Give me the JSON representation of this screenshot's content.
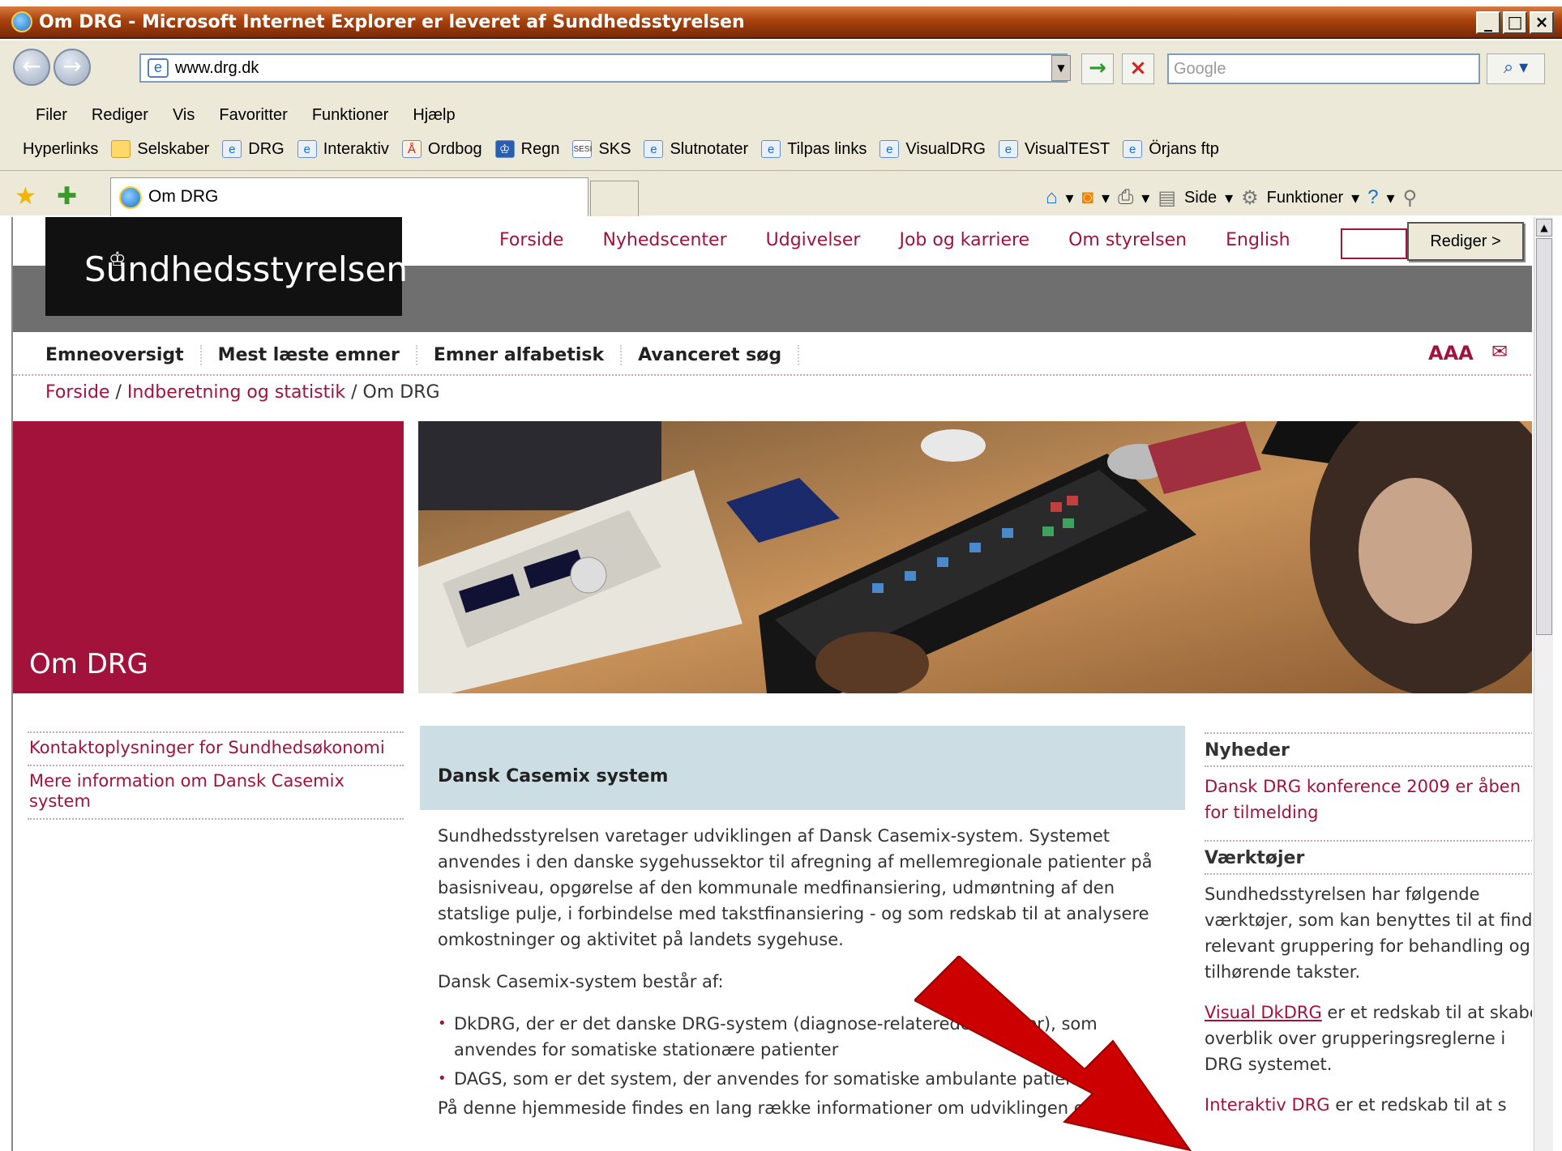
{
  "window": {
    "title": "Om DRG - Microsoft Internet Explorer er leveret af Sundhedsstyrelsen"
  },
  "address": {
    "url": "www.drg.dk",
    "search_placeholder": "Google"
  },
  "menu": [
    "Filer",
    "Rediger",
    "Vis",
    "Favoritter",
    "Funktioner",
    "Hjælp"
  ],
  "links_bar": {
    "label": "Hyperlinks",
    "items": [
      "Selskaber",
      "DRG",
      "Interaktiv",
      "Ordbog",
      "Regn",
      "SKS",
      "Slutnotater",
      "Tilpas links",
      "VisualDRG",
      "VisualTEST",
      "Örjans ftp"
    ]
  },
  "tab": {
    "label": "Om DRG"
  },
  "commandbar": {
    "side": "Side",
    "funktioner": "Funktioner"
  },
  "site": {
    "logo": "Sundhedsstyrelsen",
    "topnav": [
      "Forside",
      "Nyhedscenter",
      "Udgivelser",
      "Job og karriere",
      "Om styrelsen",
      "English"
    ],
    "rediger": "Rediger >",
    "subnav": [
      "Emneoversigt",
      "Mest læste emner",
      "Emner alfabetisk",
      "Avanceret søg"
    ],
    "text_size": "AAA",
    "breadcrumb": {
      "home": "Forside",
      "section": "Indberetning og statistik",
      "current": "Om DRG"
    },
    "page_title": "Om DRG",
    "left_links": [
      "Kontaktoplysninger for Sundhedsøkonomi",
      "Mere information om Dansk Casemix system"
    ],
    "main": {
      "heading": "Dansk Casemix system",
      "p1": "Sundhedsstyrelsen varetager udviklingen af Dansk Casemix-system. Systemet anvendes i den danske sygehussektor til afregning af mellemregionale patienter på basisniveau, opgørelse af den kommunale medfinansiering, udmøntning af den statslige pulje, i forbindelse med takstfinansiering - og som redskab til at analysere omkostninger og aktivitet på landets sygehuse.",
      "p2": "Dansk Casemix-system består af:",
      "bullet1": "DkDRG, der er det danske DRG-system (diagnose-relaterede grupper), som anvendes for somatiske stationære patienter",
      "bullet2": "DAGS, som er det system, der anvendes for somatiske ambulante patienter",
      "p3": "På denne hjemmeside findes en lang række informationer om udviklingen og"
    },
    "right": {
      "news_heading": "Nyheder",
      "news_item": "Dansk DRG konference 2009 er åben for tilmelding",
      "tools_heading": "Værktøjer",
      "tools_text": "Sundhedsstyrelsen har følgende værktøjer, som kan benyttes til at finde relevant gruppering for behandling og tilhørende takster.",
      "visual_link": "Visual DkDRG",
      "visual_text": " er et redskab til at skabe overblik over grupperingsreglerne i DRG systemet.",
      "interaktiv_link": "Interaktiv DRG",
      "interaktiv_text": " er et redskab til at s"
    }
  }
}
